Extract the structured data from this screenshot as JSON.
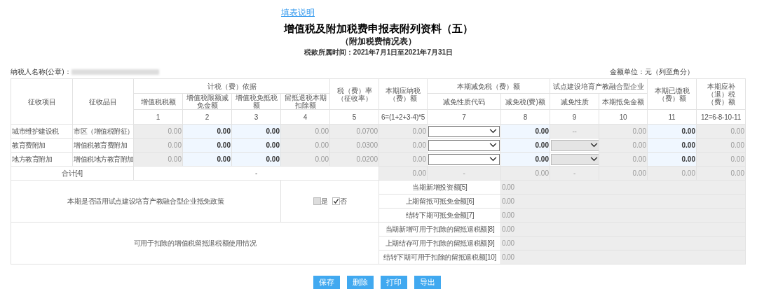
{
  "help_link": "填表说明",
  "title": "增值税及附加税费申报表附列资料（五）",
  "subtitle": "（附加税费情况表）",
  "period": "税款所属时间：2021年7月1日至2021年7月31日",
  "taxpayer_label": "纳税人名称(公章)：",
  "unit": "金额单位：元（列至角分）",
  "header": {
    "item": "征收项目",
    "subitem": "征收品目",
    "groups": [
      {
        "label": "计税（费）依据",
        "columns": [
          "增值税税额",
          "增值税限额减免金额",
          "增值税免抵税额",
          "留抵退税本期扣除额"
        ]
      },
      {
        "label": "税（费）率（征收率）"
      },
      {
        "label": "本期应纳税（费）额"
      },
      {
        "label": "本期减免税（费）额",
        "columns": [
          "减免性质代码",
          "减免税(费)额"
        ]
      },
      {
        "label": "试点建设培育产教融合型企业",
        "columns": [
          "减免性质",
          "本期抵免金额"
        ]
      },
      {
        "label": "本期已缴税（费）额"
      },
      {
        "label": "本期应补（退）税（费）额"
      }
    ],
    "numbers": [
      "1",
      "2",
      "3",
      "4",
      "5",
      "6=(1+2+3-4)*5",
      "7",
      "8",
      "9",
      "10",
      "11",
      "12=6-8-10-11"
    ]
  },
  "rows": [
    {
      "item": "城市维护建设税",
      "subitem": "市区（增值税附征）",
      "cells": [
        {
          "kind": "readonly",
          "value": "0.00"
        },
        {
          "kind": "input",
          "value": "0.00"
        },
        {
          "kind": "input",
          "value": "0.00"
        },
        {
          "kind": "readonly",
          "value": "0.00"
        },
        {
          "kind": "readonly",
          "value": "0.0700"
        },
        {
          "kind": "readonly",
          "value": "0.00"
        },
        {
          "kind": "select",
          "disabled": false
        },
        {
          "kind": "input",
          "value": "0.00"
        },
        {
          "kind": "center",
          "value": "--"
        },
        {
          "kind": "readonly",
          "value": "0.00"
        },
        {
          "kind": "input",
          "value": "0.00"
        },
        {
          "kind": "readonly",
          "value": "0.00"
        }
      ]
    },
    {
      "item": "教育费附加",
      "subitem": "增值税教育费附加",
      "cells": [
        {
          "kind": "readonly",
          "value": "0.00"
        },
        {
          "kind": "input",
          "value": "0.00"
        },
        {
          "kind": "input",
          "value": "0.00"
        },
        {
          "kind": "readonly",
          "value": "0.00"
        },
        {
          "kind": "readonly",
          "value": "0.0300"
        },
        {
          "kind": "readonly",
          "value": "0.00"
        },
        {
          "kind": "select",
          "disabled": false
        },
        {
          "kind": "input",
          "value": "0.00"
        },
        {
          "kind": "select",
          "disabled": true
        },
        {
          "kind": "readonly",
          "value": "0.00"
        },
        {
          "kind": "input",
          "value": "0.00"
        },
        {
          "kind": "readonly",
          "value": "0.00"
        }
      ]
    },
    {
      "item": "地方教育附加",
      "subitem": "增值税地方教育附加",
      "cells": [
        {
          "kind": "readonly",
          "value": "0.00"
        },
        {
          "kind": "input",
          "value": "0.00"
        },
        {
          "kind": "input",
          "value": "0.00"
        },
        {
          "kind": "readonly",
          "value": "0.00"
        },
        {
          "kind": "readonly",
          "value": "0.0200"
        },
        {
          "kind": "readonly",
          "value": "0.00"
        },
        {
          "kind": "select",
          "disabled": false
        },
        {
          "kind": "input",
          "value": "0.00"
        },
        {
          "kind": "select",
          "disabled": true
        },
        {
          "kind": "readonly",
          "value": "0.00"
        },
        {
          "kind": "input",
          "value": "0.00"
        },
        {
          "kind": "readonly",
          "value": "0.00"
        }
      ]
    }
  ],
  "total": {
    "label": "合计[4]",
    "basis": "-",
    "cells": [
      {
        "kind": "readonly",
        "value": "0.00"
      },
      {
        "kind": "center",
        "value": "-"
      },
      {
        "kind": "readonly",
        "value": "0.00"
      },
      {
        "kind": "center",
        "value": "-"
      },
      {
        "kind": "readonly",
        "value": "0.00"
      },
      {
        "kind": "readonly",
        "value": "0.00"
      },
      {
        "kind": "readonly",
        "value": "0.00"
      }
    ]
  },
  "policy": {
    "label": "本期是否适用试点建设培育产教融合型企业抵免政策",
    "options": [
      {
        "label": "是",
        "checked": false
      },
      {
        "label": "否",
        "checked": true
      }
    ],
    "lines": [
      {
        "label": "当期新增投资额[5]",
        "value": "0.00"
      },
      {
        "label": "上期留抵可抵免金额[6]",
        "value": "0.00"
      },
      {
        "label": "结转下期可抵免金额[7]",
        "value": "0.00"
      }
    ]
  },
  "retained": {
    "label": "可用于扣除的增值税留抵退税额使用情况",
    "lines": [
      {
        "label": "当期新增可用于扣除的留抵退税额[8]",
        "value": "0.00"
      },
      {
        "label": "上期结存可用于扣除的留抵退税额[9]",
        "value": "0.00"
      },
      {
        "label": "结转下期可用于扣除的留抵退税额[10]",
        "value": "0.00"
      }
    ]
  },
  "buttons": [
    "保存",
    "删除",
    "打印",
    "导出"
  ]
}
